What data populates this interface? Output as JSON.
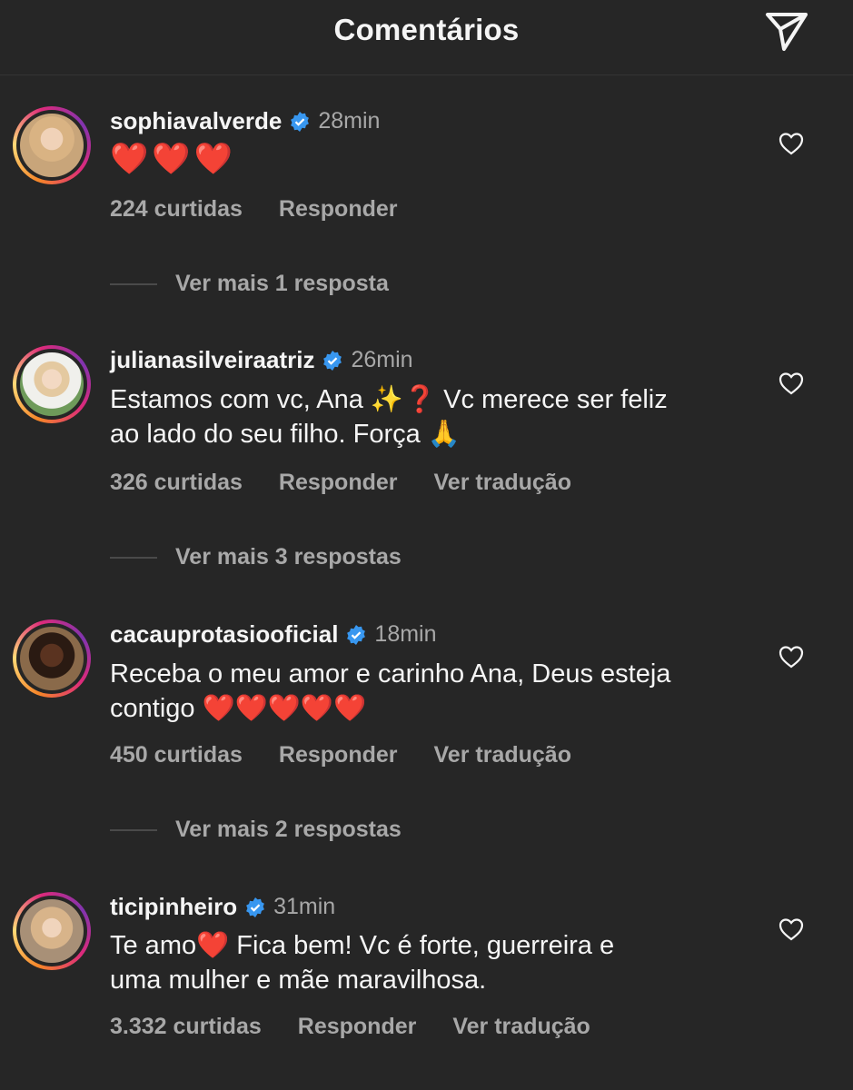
{
  "header": {
    "title": "Comentários",
    "send_icon": "paper-plane-icon"
  },
  "colors": {
    "background": "#262626",
    "text": "#f5f5f5",
    "secondary_text": "#a8a8a8",
    "verified_badge": "#3897f0",
    "heart": "#e0201f"
  },
  "comments": [
    {
      "username": "sophiavalverde",
      "time": "28min",
      "text": "❤️❤️❤️",
      "likes": "224 curtidas",
      "reply": "Responder",
      "translate": "",
      "more_replies": "Ver mais 1 resposta"
    },
    {
      "username": "julianasilveiraatriz",
      "time": "26min",
      "text_line1": "Estamos com vc, Ana ✨❓ Vc merece ser feliz",
      "text_line2": "ao lado do seu filho. Força 🙏",
      "likes": "326 curtidas",
      "reply": "Responder",
      "translate": "Ver tradução",
      "more_replies": "Ver mais 3 respostas"
    },
    {
      "username": "cacauprotasiooficial",
      "time": "18min",
      "text_line1": "Receba o meu amor e carinho Ana, Deus esteja",
      "text_line2": "contigo ❤️❤️❤️❤️❤️",
      "likes": "450 curtidas",
      "reply": "Responder",
      "translate": "Ver tradução",
      "more_replies": "Ver mais 2 respostas"
    },
    {
      "username": "ticipinheiro",
      "time": "31min",
      "text_line1": "Te amo❤️ Fica bem! Vc é forte, guerreira e",
      "text_line2": "uma mulher e mãe maravilhosa.",
      "likes": "3.332 curtidas",
      "reply": "Responder",
      "translate": "Ver tradução"
    }
  ]
}
